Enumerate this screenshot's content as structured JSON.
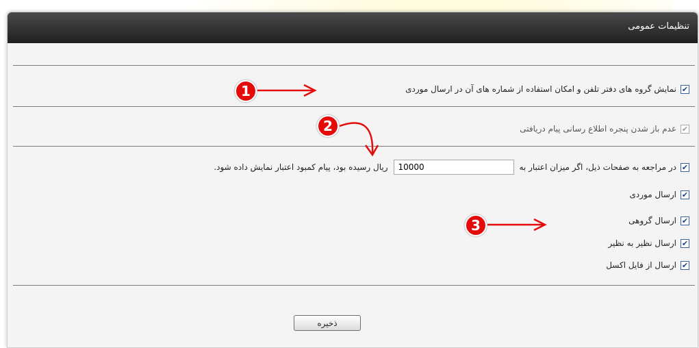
{
  "header": {
    "title": "تنظیمات عمومی"
  },
  "options": {
    "show_phonebook_groups": {
      "label": "نمایش گروه های دفتر تلفن و امکان استفاده از شماره های آن در ارسال موردی",
      "checked": true
    },
    "disable_notification_window": {
      "label": "عدم باز شدن پنجره اطلاع رسانی پیام دریافتی",
      "checked": true,
      "disabled": true
    },
    "low_credit": {
      "label_before": "در مراجعه به صفحات ذیل، اگر میزان اعتبار به",
      "value": "10000",
      "label_after": "ریال رسیده بود، پیام کمبود اعتبار نمایش داده شود.",
      "checked": true
    },
    "pages": [
      {
        "label": "ارسال موردی",
        "checked": true
      },
      {
        "label": "ارسال گروهی",
        "checked": true
      },
      {
        "label": "ارسال نظیر به نظیر",
        "checked": true
      },
      {
        "label": "ارسال از فایل اکسل",
        "checked": true
      }
    ]
  },
  "actions": {
    "save_label": "ذخیره"
  },
  "annotations": {
    "marker_1": "1",
    "marker_2": "2",
    "marker_3": "3",
    "color": "#e50b0b"
  }
}
